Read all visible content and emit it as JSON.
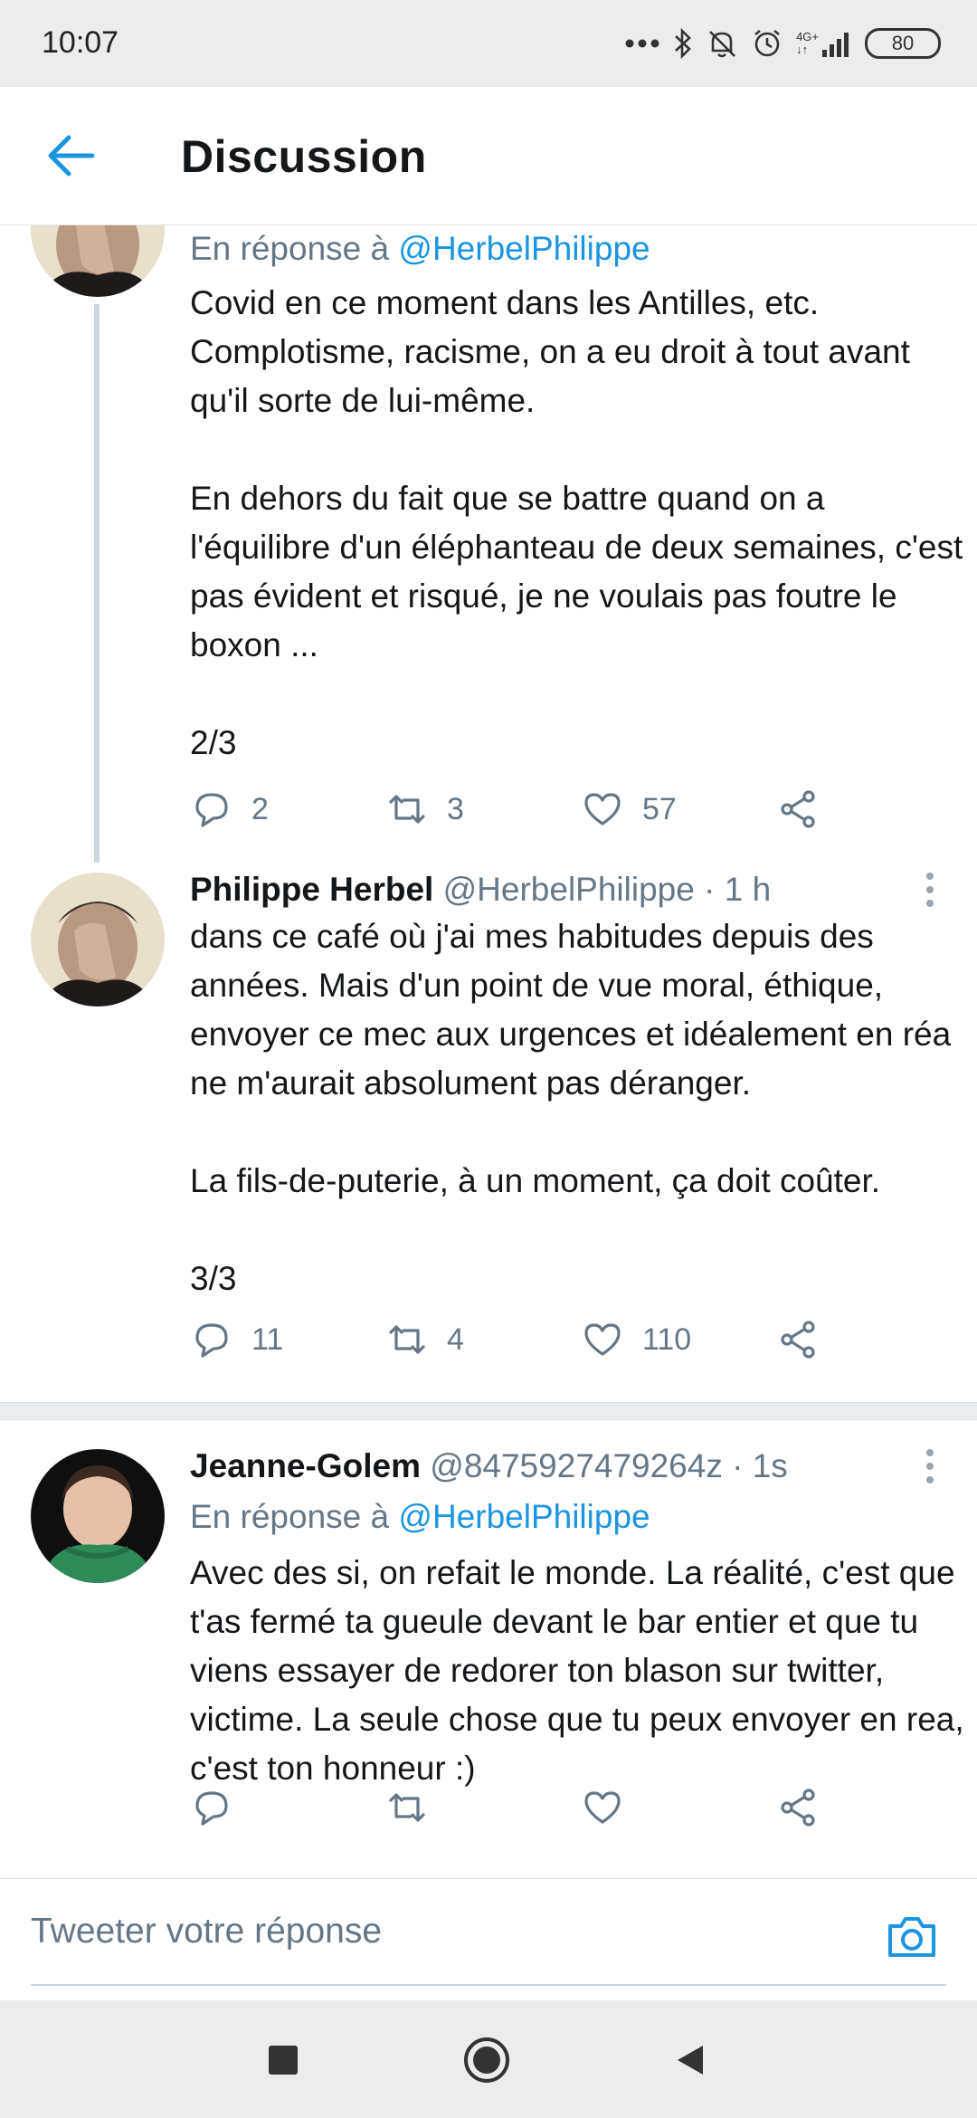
{
  "status_bar": {
    "time": "10:07",
    "network_label_top": "4G+",
    "network_label_bottom": "↓↑",
    "battery": "80",
    "icons": [
      "dots-icon",
      "bluetooth-icon",
      "dnd-icon",
      "alarm-icon",
      "signal-icon",
      "battery-icon"
    ]
  },
  "app_bar": {
    "title": "Discussion",
    "back_icon": "back-arrow-icon"
  },
  "tweets": [
    {
      "reply_prefix": "En réponse à ",
      "reply_handle": "@HerbelPhilippe",
      "text": "Covid en ce moment dans les Antilles, etc. Complotisme, racisme, on a eu droit à tout avant qu'il sorte de lui-même.\n\nEn dehors du fait que se battre quand on a l'équilibre d'un éléphanteau de deux semaines, c'est pas évident et risqué, je ne voulais pas foutre le boxon ...\n\n2/3",
      "replies": "2",
      "retweets": "3",
      "likes": "57"
    },
    {
      "name": "Philippe Herbel",
      "meta": " @HerbelPhilippe · 1 h",
      "text": "dans ce café où j'ai mes habitudes depuis des années. Mais d'un point de vue moral, éthique, envoyer ce mec aux urgences et idéalement en réa ne m'aurait absolument pas déranger.\n\nLa fils-de-puterie, à un moment, ça doit coûter.\n\n3/3",
      "replies": "11",
      "retweets": "4",
      "likes": "110"
    },
    {
      "name": "Jeanne-Golem",
      "meta": " @8475927479264z · 1s",
      "reply_prefix": "En réponse à ",
      "reply_handle": "@HerbelPhilippe",
      "text": "Avec des si, on refait le monde. La réalité, c'est que t'as fermé ta gueule devant le bar entier et que tu viens essayer de redorer ton blason sur twitter, victime. La seule chose que tu peux envoyer en rea, c'est ton honneur :)",
      "replies": "",
      "retweets": "",
      "likes": ""
    }
  ],
  "reply_bar": {
    "placeholder": "Tweeter votre réponse",
    "camera_icon": "camera-icon"
  },
  "colors": {
    "accent": "#1b95e0",
    "muted": "#657786",
    "text": "#14171a"
  }
}
